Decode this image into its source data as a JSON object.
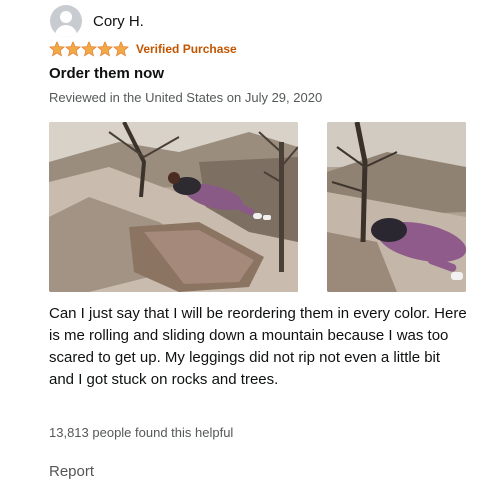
{
  "reviewer": {
    "name": "Cory H.",
    "avatar_icon": "default-avatar-icon"
  },
  "rating": {
    "stars": 5,
    "max": 5,
    "star_color": "#f3a847",
    "badge": "Verified Purchase",
    "badge_color": "#c45500"
  },
  "review": {
    "title": "Order them now",
    "date": "Reviewed in the United States on July 29, 2020",
    "body": "Can I just say that I will be reordering them in every color. Here is me rolling and sliding down a mountain because I was too scared to get up. My leggings did not rip not even a little bit and I got stuck on rocks and trees."
  },
  "helpful": {
    "text": "13,813 people found this helpful"
  },
  "actions": {
    "report_label": "Report"
  }
}
